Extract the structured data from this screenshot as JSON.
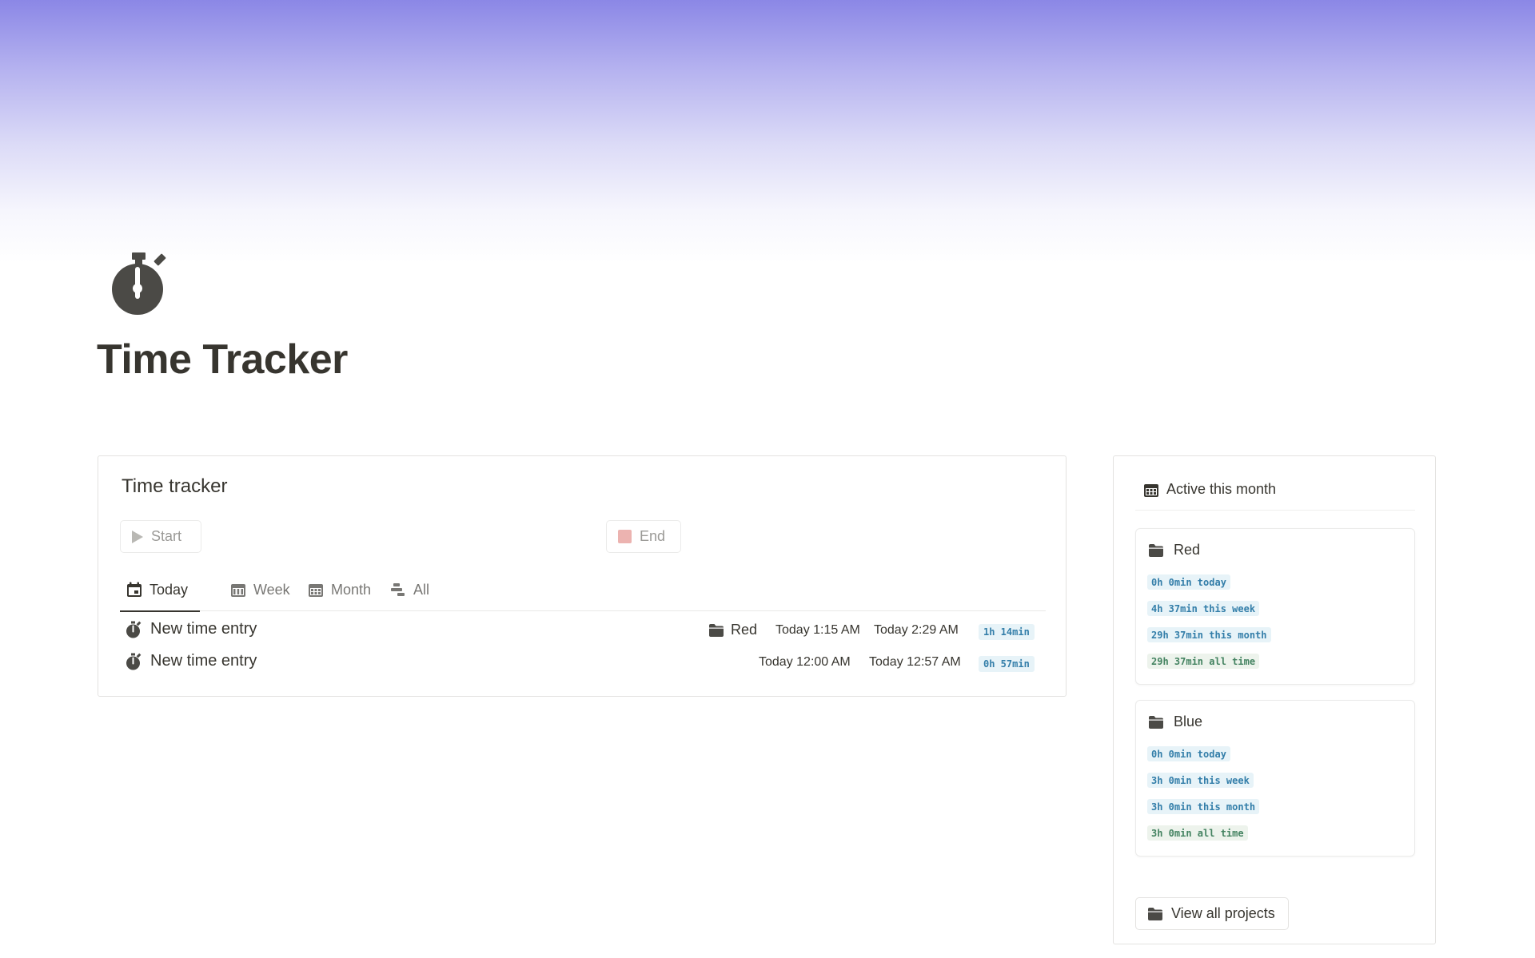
{
  "page": {
    "title": "Time Tracker",
    "icon": "stopwatch-icon",
    "cover_colors": [
      "#8b87e6",
      "#ffffff"
    ]
  },
  "tracker": {
    "title": "Time tracker",
    "start_label": "Start",
    "end_label": "End",
    "tabs": [
      {
        "label": "Today",
        "icon": "calendar-day-icon",
        "active": true
      },
      {
        "label": "Week",
        "icon": "calendar-week-icon",
        "active": false
      },
      {
        "label": "Month",
        "icon": "calendar-month-icon",
        "active": false
      },
      {
        "label": "All",
        "icon": "timeline-icon",
        "active": false
      }
    ],
    "entries": [
      {
        "name": "New time entry",
        "project": "Red",
        "start": "Today 1:15 AM",
        "end": "Today 2:29 AM",
        "duration": "1h 14min"
      },
      {
        "name": "New time entry",
        "project": "",
        "start": "Today 12:00 AM",
        "end": "Today 12:57 AM",
        "duration": "0h 57min"
      }
    ]
  },
  "sidebar": {
    "title": "Active this month",
    "projects": [
      {
        "name": "Red",
        "today": "0h 0min today",
        "week": "4h 37min this week",
        "month": "29h 37min this month",
        "all_time": "29h 37min all time"
      },
      {
        "name": "Blue",
        "today": "0h 0min today",
        "week": "3h 0min this week",
        "month": "3h 0min this month",
        "all_time": "3h 0min all time"
      }
    ],
    "view_all_label": "View all projects"
  },
  "colors": {
    "text": "#37352f",
    "muted": "#787774",
    "badge_blue_bg": "#e7f3f8",
    "badge_blue_text": "#337ea9",
    "badge_green_bg": "#edf3ec",
    "badge_green_text": "#448361",
    "stop_red": "#ecb3b0"
  }
}
